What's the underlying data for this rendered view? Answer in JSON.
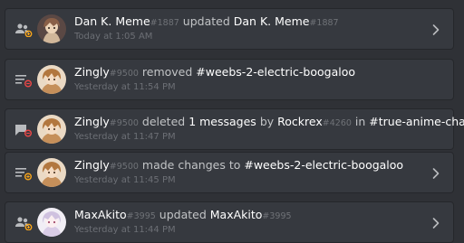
{
  "entries": [
    {
      "action": "member-update",
      "user": "Dan K. Meme",
      "user_disc": "#1887",
      "verb": "updated",
      "target": "Dan K. Meme",
      "target_disc": "#1887",
      "time": "Today at 1:05 AM",
      "expandable": true
    },
    {
      "action": "channel-delete",
      "user": "Zingly",
      "user_disc": "#9500",
      "verb": "removed",
      "target": "#weebs-2-electric-boogaloo",
      "time": "Yesterday at 11:54 PM",
      "expandable": false
    },
    {
      "action": "message-delete",
      "user": "Zingly",
      "user_disc": "#9500",
      "verb": "deleted",
      "count": "1 messages",
      "by": "by",
      "author": "Rockrex",
      "author_disc": "#4260",
      "in": "in",
      "channel": "#true-anime-chan",
      "time": "Yesterday at 11:47 PM",
      "expandable": false
    },
    {
      "action": "channel-update",
      "user": "Zingly",
      "user_disc": "#9500",
      "verb": "made changes to",
      "target": "#weebs-2-electric-boogaloo",
      "time": "Yesterday at 11:45 PM",
      "expandable": true
    },
    {
      "action": "member-update",
      "user": "MaxAkito",
      "user_disc": "#3995",
      "verb": "updated",
      "target": "MaxAkito",
      "target_disc": "#3995",
      "time": "Yesterday at 11:44 PM",
      "expandable": true
    }
  ],
  "colors": {
    "background": "#2f3136",
    "card": "#36393f",
    "delete_red": "#f04747",
    "update_yellow": "#faa61a",
    "icon_gray": "#b9bbbe"
  }
}
